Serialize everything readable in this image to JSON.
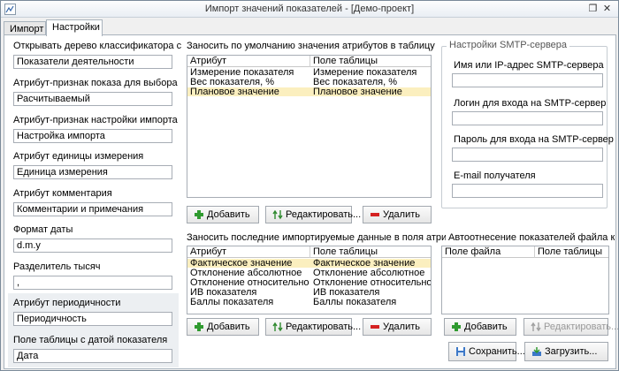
{
  "window": {
    "title": "Импорт значений показателей - [Демо-проект]",
    "controls": {
      "restore": "❐",
      "close": "✕"
    }
  },
  "tabs": [
    {
      "label": "Импорт"
    },
    {
      "label": "Настройки",
      "active": true
    }
  ],
  "left": {
    "tree_label": "Открывать дерево классификатора с",
    "tree_value": "Показатели деятельности",
    "show_attr_label": "Атрибут-признак показа для выбора",
    "show_attr_value": "Расчитываемый",
    "import_attr_label": "Атрибут-признак настройки импорта",
    "import_attr_value": "Настройка импорта",
    "unit_label": "Атрибут единицы измерения",
    "unit_value": "Единица измерения",
    "comment_label": "Атрибут комментария",
    "comment_value": "Комментарии и примечания",
    "date_format_label": "Формат даты",
    "date_format_value": "d.m.y",
    "thousands_label": "Разделитель тысяч",
    "thousands_value": ",",
    "period_label": "Атрибут периодичности",
    "period_value": "Периодичность",
    "date_field_label": "Поле таблицы с датой показателя",
    "date_field_value": "Дата"
  },
  "defaults_table": {
    "title": "Заносить по умолчанию значения атрибутов в таблицу",
    "columns": [
      "Атрибут",
      "Поле таблицы"
    ],
    "rows": [
      [
        "Измерение показателя",
        "Измерение показателя"
      ],
      [
        "Вес показателя, %",
        "Вес показателя, %"
      ],
      [
        "Плановое значение",
        "Плановое значение"
      ]
    ],
    "buttons": {
      "add": "Добавить",
      "edit": "Редактировать...",
      "delete": "Удалить"
    }
  },
  "last_import_table": {
    "title": "Заносить последние  импортируемые данные в поля атрибутов",
    "columns": [
      "Атрибут",
      "Поле таблицы"
    ],
    "rows": [
      [
        "Фактическое значение",
        "Фактическое значение"
      ],
      [
        "Отклонение абсолютное",
        "Отклонение абсолютное"
      ],
      [
        "Отклонение относительное, %",
        "Отклонение относительное, %"
      ],
      [
        "ИВ показателя",
        "ИВ показателя"
      ],
      [
        "Баллы показателя",
        "Баллы показателя"
      ]
    ],
    "buttons": {
      "add": "Добавить",
      "edit": "Редактировать...",
      "delete": "Удалить"
    }
  },
  "smtp": {
    "title": "Настройки SMTP-сервера",
    "server_label": "Имя или IP-адрес SMTP-сервера",
    "server_value": "",
    "login_label": "Логин для входа на SMTP-сервер",
    "login_value": "",
    "password_label": "Пароль для входа на SMTP-сервер",
    "password_value": "",
    "email_label": "E-mail получателя",
    "email_value": ""
  },
  "auto_map": {
    "title": "Автоотнесение показателей файла  к по",
    "columns": [
      "Поле файла",
      "Поле таблицы"
    ],
    "buttons": {
      "add": "Добавить",
      "edit": "Редактировать..."
    }
  },
  "bottom_buttons": {
    "save": "Сохранить...",
    "load": "Загрузить..."
  },
  "colors": {
    "selected_row": "#fbefbf",
    "add_icon": "#2f9a2f",
    "delete_icon": "#d42020"
  }
}
